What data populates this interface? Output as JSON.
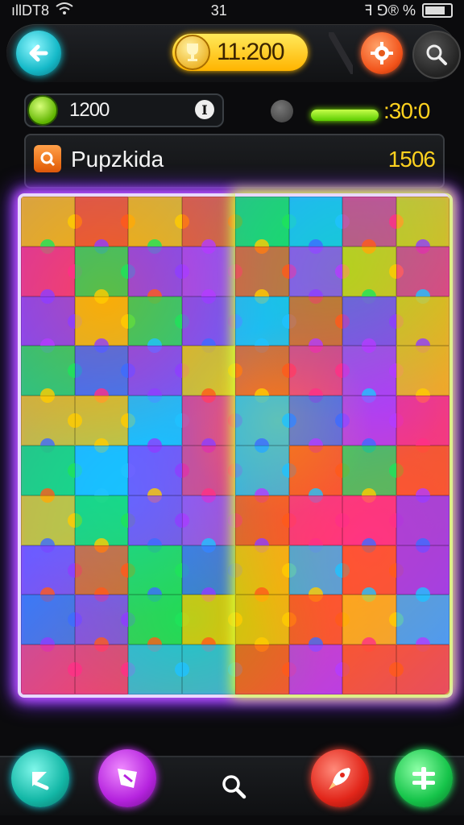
{
  "status_bar": {
    "carrier": "ıllDT8",
    "time": "31",
    "indicators": "ꟻ ⅁® %"
  },
  "top_bar": {
    "back_icon": "arrow-left-icon",
    "coins_value": "11:200",
    "coin_icon": "trophy-coin-icon",
    "settings_icon": "gear-icon",
    "search_icon": "search-icon"
  },
  "stats": {
    "gems_value": "1200",
    "info_label": "I",
    "timer_value": ":30:0",
    "timer_progress": 1.0
  },
  "panel": {
    "title": "Pupzkida",
    "score": "1506",
    "icon": "search-box-icon"
  },
  "board": {
    "rows": 10,
    "cols": 8,
    "colors": [
      "#ff5a1a",
      "#8f3dff",
      "#1fc2ff",
      "#ffcc00",
      "#1ee35a",
      "#ff2f86",
      "#3d6bff",
      "#b43bff"
    ]
  },
  "bottom_bar": {
    "hint_icon": "arrow-up-left-icon",
    "shop_icon": "flag-card-icon",
    "search_icon": "search-icon",
    "rocket_icon": "rocket-icon",
    "menu_icon": "cross-menu-icon"
  }
}
